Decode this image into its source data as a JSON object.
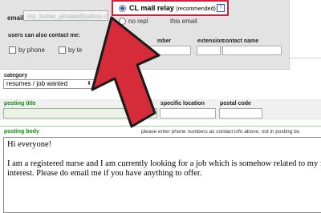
{
  "contact": {
    "email_label": "email",
    "email_value": "my_home_private@yahoo.com",
    "relay_option": "CL mail relay",
    "relay_recommended": "(recommended)",
    "relay_help_glyph": "?",
    "no_relay_option": "no repl",
    "no_relay_suffix": "this email",
    "also_contact_label": "users can also contact me:",
    "by_phone_label": "by phone",
    "by_text_label": "by te",
    "phone_number_label": "mber",
    "extension_label": "extension",
    "contact_name_label": "contact name"
  },
  "category": {
    "label": "category",
    "selected": "resumes / job wanted"
  },
  "fields": {
    "posting_title_label": "posting title",
    "specific_location_label": "specific location",
    "postal_code_label": "postal code",
    "posting_body_label": "posting body",
    "posting_body_hint": "please enter phone numbers as contact info above, not in posting bo"
  },
  "body_text": {
    "line1": "Hi everyone!",
    "line2": "I am a registered nurse and I am currently looking for a job which is somehow related to my field",
    "line3": "interest. Please do email me if you have anything to offer."
  },
  "colors": {
    "arrow_fill": "#d62b39",
    "arrow_stroke": "#1a1a1a",
    "highlight_border": "#d21f3c",
    "label_green": "#138c13"
  },
  "icons": {
    "help": "question-mark-icon",
    "pointer": "big-red-arrow-icon"
  }
}
